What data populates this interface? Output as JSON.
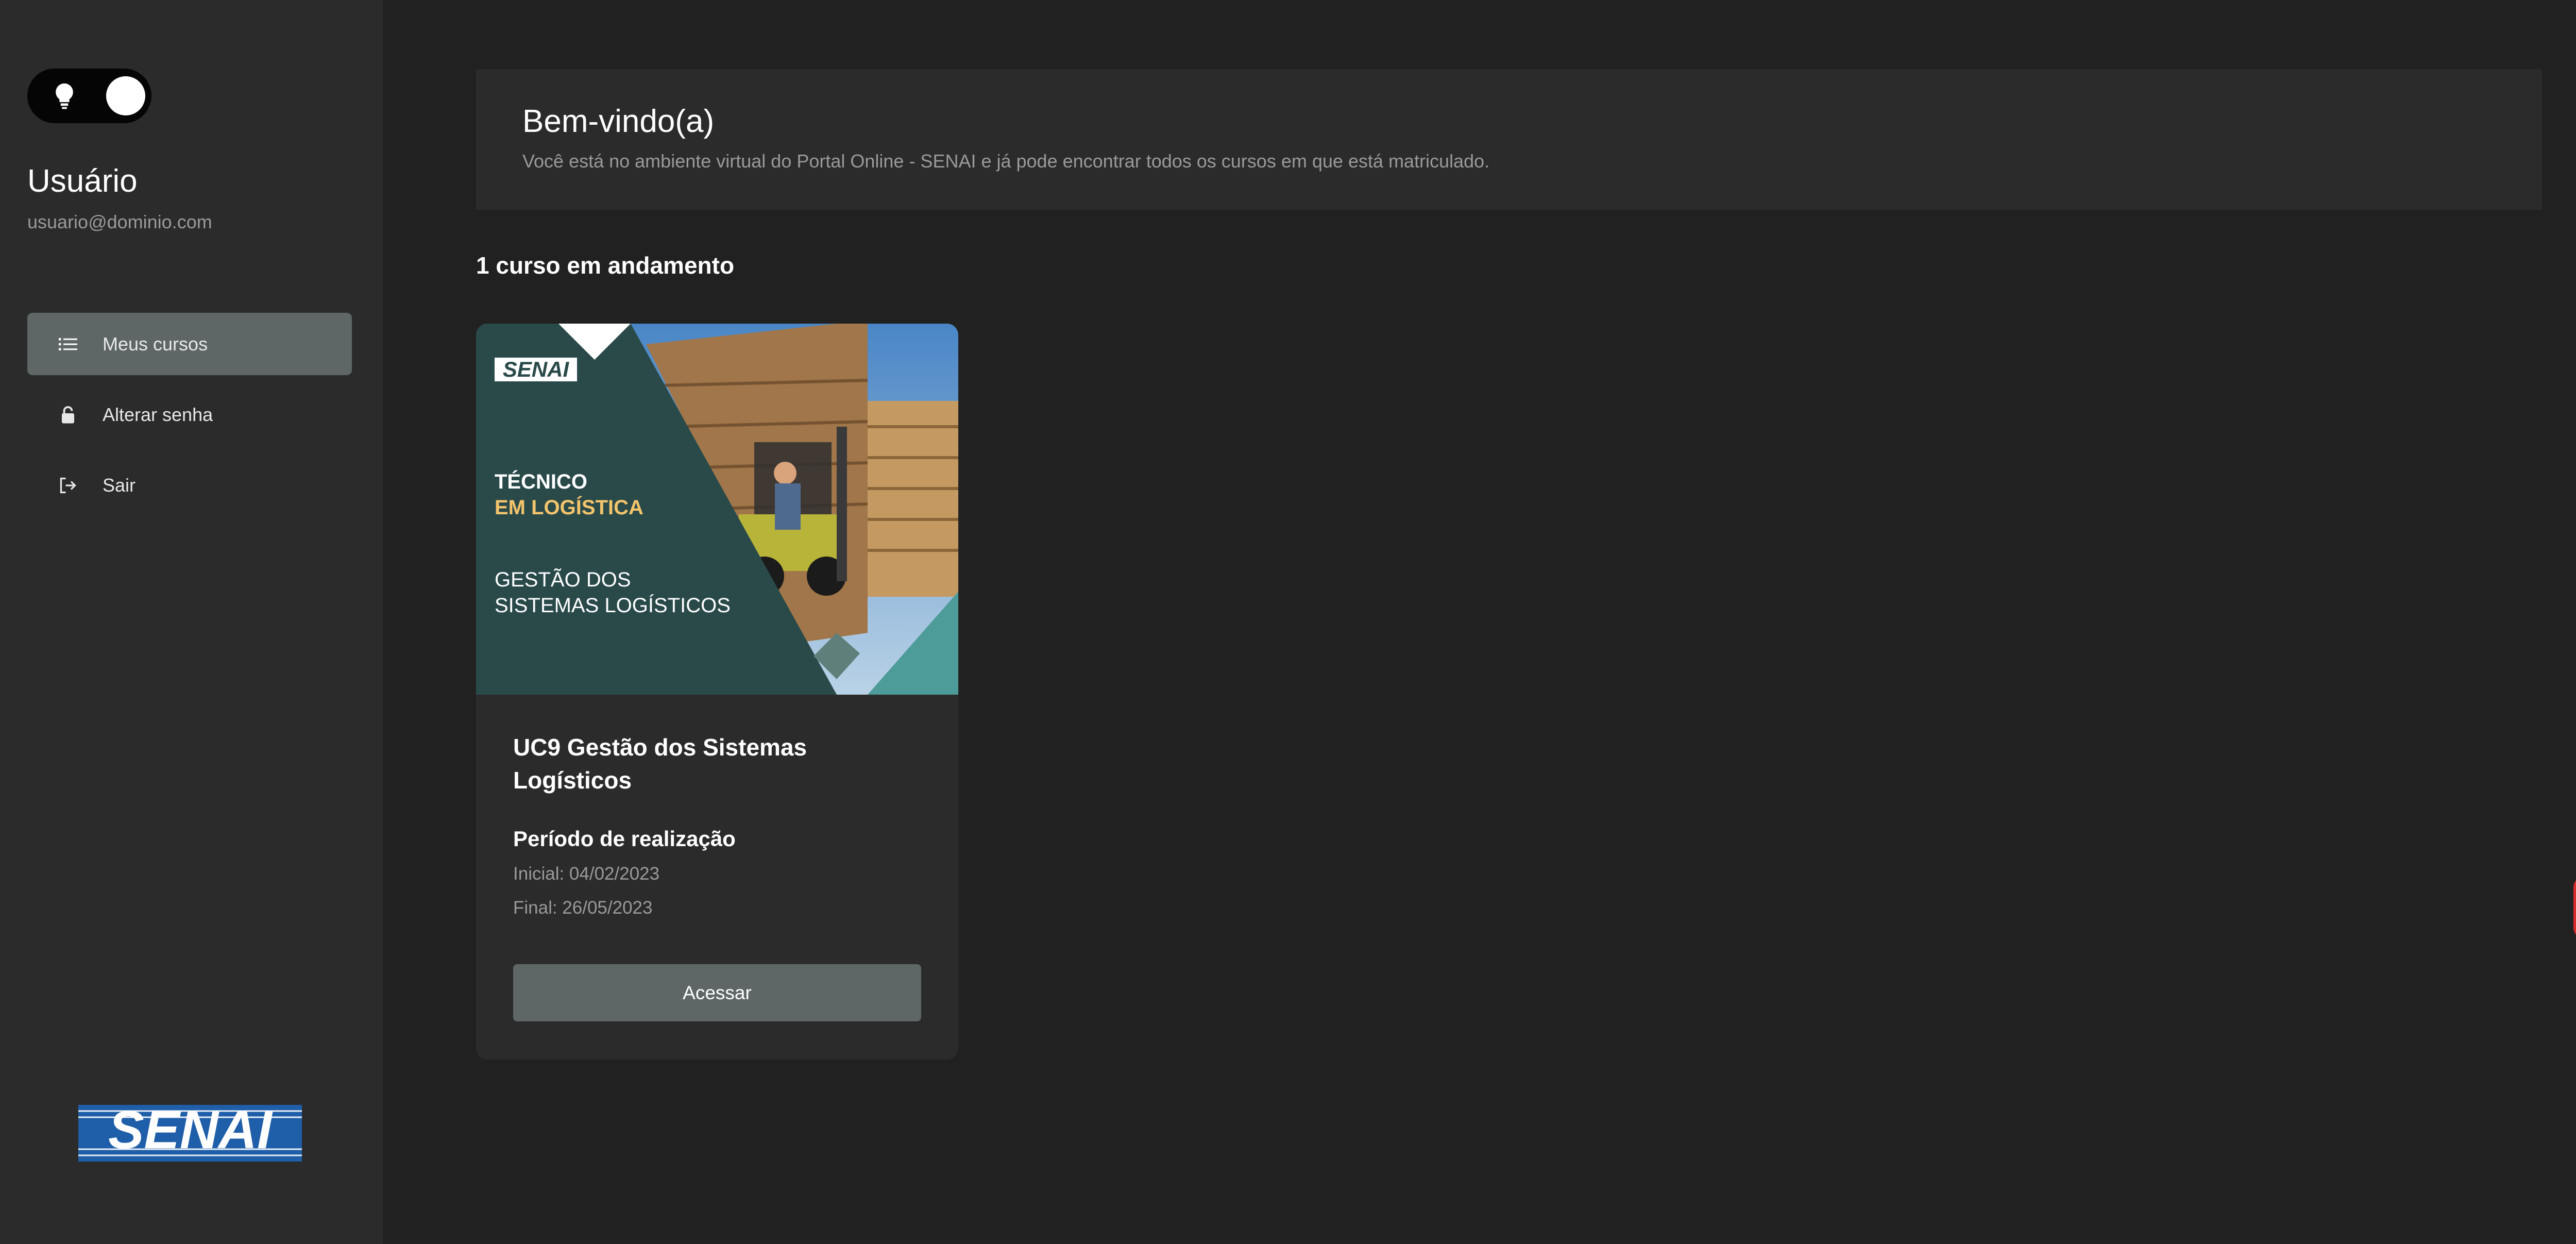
{
  "sidebar": {
    "theme_toggle": {
      "icon": "lightbulb-icon",
      "state": "dark"
    },
    "user": {
      "name": "Usuário",
      "email": "usuario@dominio.com"
    },
    "nav": [
      {
        "label": "Meus cursos",
        "icon": "list-icon",
        "active": true
      },
      {
        "label": "Alterar senha",
        "icon": "lock-icon",
        "active": false
      },
      {
        "label": "Sair",
        "icon": "logout-icon",
        "active": false
      }
    ],
    "logo_text": "SENAI"
  },
  "main": {
    "welcome": {
      "title": "Bem-vindo(a)",
      "subtitle": "Você está no ambiente virtual do Portal Online - SENAI e já pode encontrar todos os cursos em que está matriculado."
    },
    "courses_heading": "1 curso em andamento",
    "courses": [
      {
        "banner": {
          "brand": "SENAI",
          "line1": "TÉCNICO",
          "line2": "EM LOGÍSTICA",
          "line3": "GESTÃO DOS",
          "line4": "SISTEMAS LOGÍSTICOS"
        },
        "title": "UC9 Gestão dos Sistemas Logísticos",
        "period_heading": "Período de realização",
        "start": "Inicial: 04/02/2023",
        "end": "Final: 26/05/2023",
        "action_label": "Acessar"
      }
    ]
  },
  "widgets": {
    "sign_language": "sign-language-icon",
    "accessibility": "accessibility-icon"
  },
  "colors": {
    "background": "#212121",
    "panel": "#2b2b2b",
    "active": "#5e6766",
    "banner_teal": "#2a4a4a",
    "banner_yellow": "#f3c46b",
    "accessibility_red": "#d92b2b",
    "vlibras_blue": "#1f5ea8"
  }
}
